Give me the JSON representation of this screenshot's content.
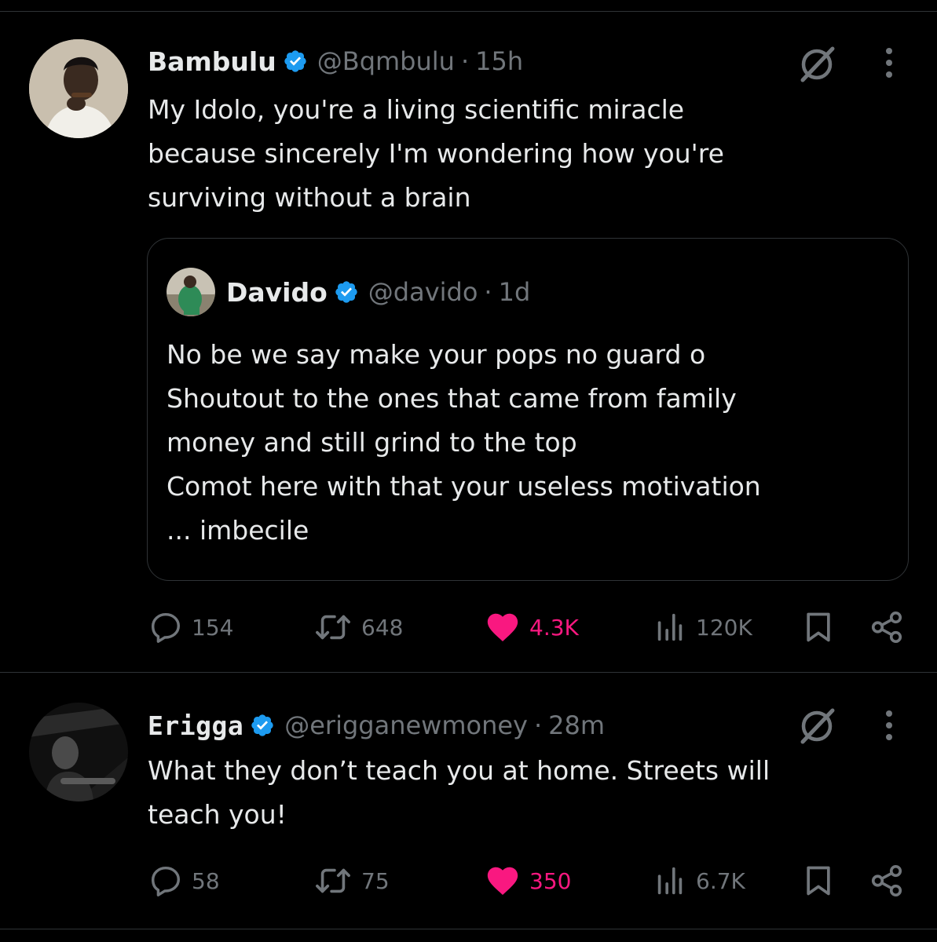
{
  "colors": {
    "background": "#000000",
    "primary_text": "#e7e9ea",
    "secondary_text": "#71767b",
    "divider": "#2f3336",
    "verified_badge": "#1d9bf0",
    "like": "#f91880"
  },
  "tweets": [
    {
      "author": {
        "name": "Bambulu",
        "handle": "@Bqmbulu",
        "verified": true,
        "avatar_icon": "avatar-photo"
      },
      "time": "15h",
      "text": "My Idolo, you're a living scientific miracle\nbecause sincerely I'm wondering how you're\nsurviving without a brain",
      "quote": {
        "author": {
          "name": "Davido",
          "handle": "@davido",
          "verified": true,
          "avatar_icon": "avatar-photo"
        },
        "time": "1d",
        "text": "No be we say make your pops no guard o\nShoutout to the ones that came from family\nmoney and still grind to the top\nComot here with that your useless motivation\n... imbecile"
      },
      "stats": {
        "replies": "154",
        "reposts": "648",
        "likes": "4.3K",
        "views": "120K",
        "liked": true
      }
    },
    {
      "author": {
        "name": "Erigga",
        "handle": "@erigganewmoney",
        "verified": true,
        "avatar_icon": "avatar-photo"
      },
      "time": "28m",
      "text": "What they don’t teach you at home. Streets will\nteach you!",
      "stats": {
        "replies": "58",
        "reposts": "75",
        "likes": "350",
        "views": "6.7K",
        "liked": true
      }
    }
  ],
  "separator": "·",
  "icons": [
    "verified-badge-icon",
    "grok-icon",
    "more-icon",
    "reply-icon",
    "repost-icon",
    "like-icon",
    "views-icon",
    "bookmark-icon",
    "share-icon"
  ]
}
